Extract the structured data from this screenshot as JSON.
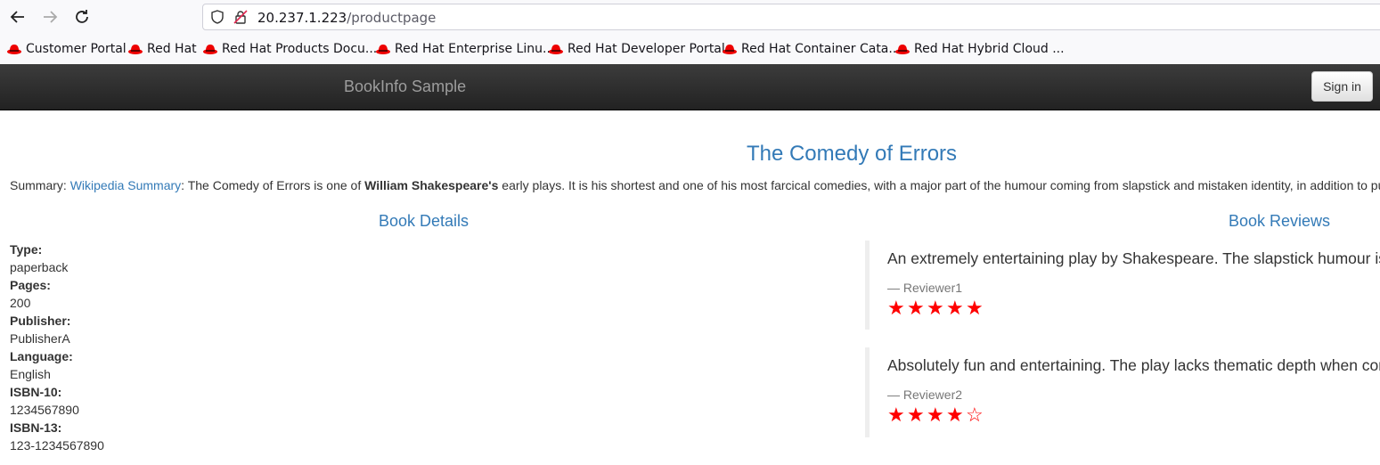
{
  "browser": {
    "url_host": "20.237.1.223",
    "url_path": "/productpage",
    "bookmarks": [
      "Customer Portal",
      "Red Hat",
      "Red Hat Products Docu...",
      "Red Hat Enterprise Linu...",
      "Red Hat Developer Portal",
      "Red Hat Container Cata...",
      "Red Hat Hybrid Cloud ..."
    ]
  },
  "navbar": {
    "brand": "BookInfo Sample",
    "signin_label": "Sign in"
  },
  "product": {
    "title": "The Comedy of Errors",
    "summary_label": "Summary: ",
    "summary_link": "Wikipedia Summary",
    "summary_pre": ": The Comedy of Errors is one of ",
    "summary_bold": "William Shakespeare's",
    "summary_post": " early plays. It is his shortest and one of his most farcical comedies, with a major part of the humour coming from slapstick and mistaken identity, in addition to pu"
  },
  "details": {
    "heading": "Book Details",
    "fields": [
      {
        "label": "Type:",
        "value": "paperback"
      },
      {
        "label": "Pages:",
        "value": "200"
      },
      {
        "label": "Publisher:",
        "value": "PublisherA"
      },
      {
        "label": "Language:",
        "value": "English"
      },
      {
        "label": "ISBN-10:",
        "value": "1234567890"
      },
      {
        "label": "ISBN-13:",
        "value": "123-1234567890"
      }
    ]
  },
  "reviews": {
    "heading": "Book Reviews",
    "items": [
      {
        "text": "An extremely entertaining play by Shakespeare. The slapstick humour is",
        "reviewer": "— Reviewer1",
        "rating": 5,
        "max": 5
      },
      {
        "text": "Absolutely fun and entertaining. The play lacks thematic depth when cor",
        "reviewer": "— Reviewer2",
        "rating": 4,
        "max": 5
      }
    ],
    "star_color": "#ff0000"
  },
  "colors": {
    "link": "#337ab7",
    "navbar": "#222222"
  }
}
